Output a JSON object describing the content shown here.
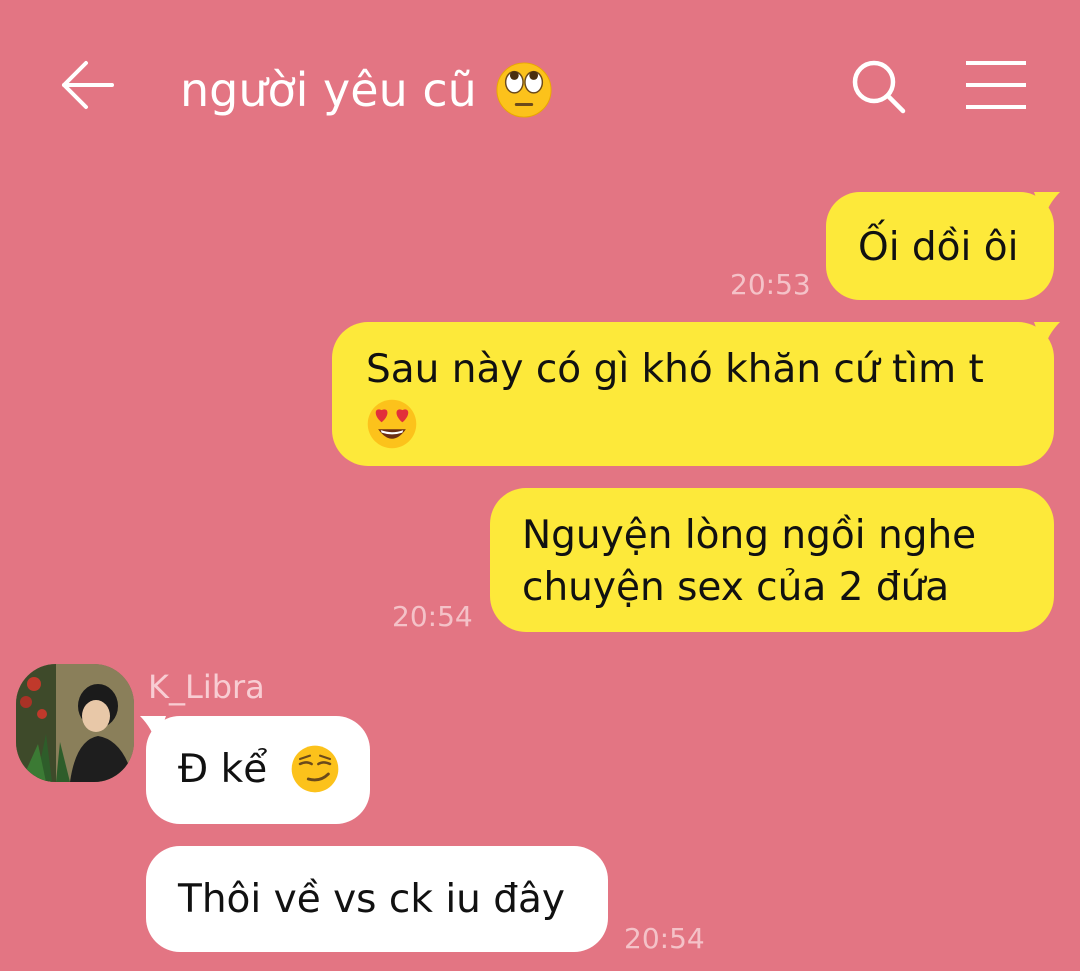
{
  "header": {
    "title": "người yêu cũ",
    "title_emoji": "eye-roll-emoji",
    "back_icon": "arrow-left-icon",
    "search_icon": "search-icon",
    "menu_icon": "hamburger-menu-icon"
  },
  "messages": [
    {
      "from": "me",
      "text": "Ối dồi ôi",
      "time": "20:53"
    },
    {
      "from": "me",
      "text": "Sau này có gì khó khăn cứ tìm t",
      "emoji": "heart-eyes-emoji"
    },
    {
      "from": "me",
      "text_line1": "Nguyện lòng ngồi nghe",
      "text_line2": "chuyện sex của 2 đứa",
      "time": "20:54"
    },
    {
      "from": "them",
      "sender": "K_Libra",
      "text": "Đ kể",
      "emoji": "smirk-emoji"
    },
    {
      "from": "them",
      "text": "Thôi về vs ck iu đây",
      "time": "20:54"
    }
  ],
  "colors": {
    "background": "#e37583",
    "my_bubble": "#fde93a",
    "their_bubble": "#ffffff",
    "time_text": "#f4c2c8"
  }
}
